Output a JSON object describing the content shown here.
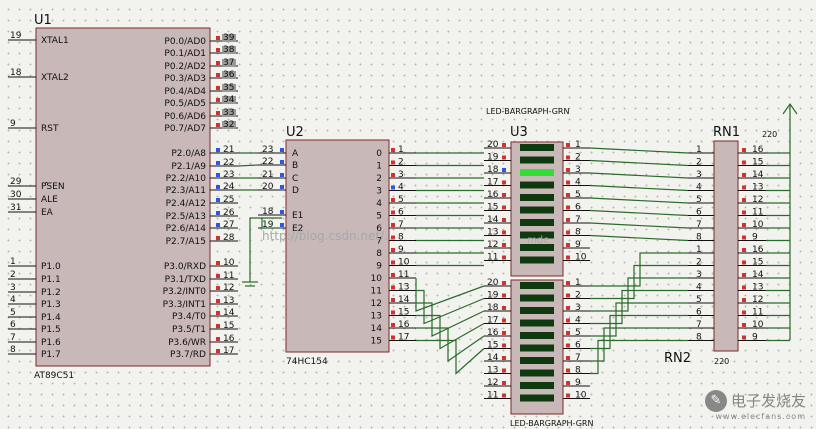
{
  "u1": {
    "ref": "U1",
    "part": "AT89C51",
    "left": [
      {
        "num": "19",
        "name": "XTAL1"
      },
      {
        "num": "18",
        "name": "XTAL2"
      },
      {
        "num": "9",
        "name": "RST"
      },
      {
        "num": "29",
        "name": "PSEN"
      },
      {
        "num": "30",
        "name": "ALE"
      },
      {
        "num": "31",
        "name": "EA"
      },
      {
        "num": "1",
        "name": "P1.0"
      },
      {
        "num": "2",
        "name": "P1.1"
      },
      {
        "num": "3",
        "name": "P1.2"
      },
      {
        "num": "4",
        "name": "P1.3"
      },
      {
        "num": "5",
        "name": "P1.4"
      },
      {
        "num": "6",
        "name": "P1.5"
      },
      {
        "num": "7",
        "name": "P1.6"
      },
      {
        "num": "8",
        "name": "P1.7"
      }
    ],
    "right": [
      {
        "num": "39",
        "name": "P0.0/AD0"
      },
      {
        "num": "38",
        "name": "P0.1/AD1"
      },
      {
        "num": "37",
        "name": "P0.2/AD2"
      },
      {
        "num": "36",
        "name": "P0.3/AD3"
      },
      {
        "num": "35",
        "name": "P0.4/AD4"
      },
      {
        "num": "34",
        "name": "P0.5/AD5"
      },
      {
        "num": "33",
        "name": "P0.6/AD6"
      },
      {
        "num": "32",
        "name": "P0.7/AD7"
      },
      {
        "num": "21",
        "name": "P2.0/A8"
      },
      {
        "num": "22",
        "name": "P2.1/A9"
      },
      {
        "num": "23",
        "name": "P2.2/A10"
      },
      {
        "num": "24",
        "name": "P2.3/A11"
      },
      {
        "num": "25",
        "name": "P2.4/A12"
      },
      {
        "num": "26",
        "name": "P2.5/A13"
      },
      {
        "num": "27",
        "name": "P2.6/A14"
      },
      {
        "num": "28",
        "name": "P2.7/A15"
      },
      {
        "num": "10",
        "name": "P3.0/RXD"
      },
      {
        "num": "11",
        "name": "P3.1/TXD"
      },
      {
        "num": "12",
        "name": "P3.2/INT0"
      },
      {
        "num": "13",
        "name": "P3.3/INT1"
      },
      {
        "num": "14",
        "name": "P3.4/T0"
      },
      {
        "num": "15",
        "name": "P3.5/T1"
      },
      {
        "num": "16",
        "name": "P3.6/WR"
      },
      {
        "num": "17",
        "name": "P3.7/RD"
      }
    ]
  },
  "u2": {
    "ref": "U2",
    "part": "74HC154",
    "left": [
      {
        "num": "23",
        "name": "A"
      },
      {
        "num": "22",
        "name": "B"
      },
      {
        "num": "21",
        "name": "C"
      },
      {
        "num": "20",
        "name": "D"
      },
      {
        "num": "18",
        "name": "E1"
      },
      {
        "num": "19",
        "name": "E2"
      }
    ],
    "right": [
      {
        "num": "1",
        "name": "0"
      },
      {
        "num": "2",
        "name": "1"
      },
      {
        "num": "3",
        "name": "2"
      },
      {
        "num": "4",
        "name": "3"
      },
      {
        "num": "5",
        "name": "4"
      },
      {
        "num": "6",
        "name": "5"
      },
      {
        "num": "7",
        "name": "6"
      },
      {
        "num": "8",
        "name": "7"
      },
      {
        "num": "9",
        "name": "8"
      },
      {
        "num": "10",
        "name": "9"
      },
      {
        "num": "11",
        "name": "10"
      },
      {
        "num": "13",
        "name": "11"
      },
      {
        "num": "14",
        "name": "12"
      },
      {
        "num": "15",
        "name": "13"
      },
      {
        "num": "16",
        "name": "14"
      },
      {
        "num": "17",
        "name": "15"
      }
    ]
  },
  "u3": {
    "ref": "U3",
    "part": "LED-BARGRAPH-GRN",
    "left_pins": [
      "20",
      "19",
      "18",
      "17",
      "16",
      "15",
      "14",
      "13",
      "12",
      "11"
    ],
    "right_pins": [
      "1",
      "2",
      "3",
      "4",
      "5",
      "6",
      "7",
      "8",
      "9",
      "10"
    ],
    "lit_segment": 3
  },
  "u4": {
    "part": "LED-BARGRAPH-GRN",
    "left_pins": [
      "20",
      "19",
      "18",
      "17",
      "16",
      "15",
      "14",
      "13",
      "12",
      "11"
    ],
    "right_pins": [
      "1",
      "2",
      "3",
      "4",
      "5",
      "6",
      "7",
      "8",
      "9",
      "10"
    ]
  },
  "rn1": {
    "ref": "RN1",
    "value": "220",
    "left_pins": [
      "1",
      "2",
      "3",
      "4",
      "5",
      "6",
      "7",
      "8"
    ],
    "right_pins": [
      "16",
      "15",
      "14",
      "13",
      "12",
      "11",
      "10",
      "9"
    ]
  },
  "rn2": {
    "ref": "RN2",
    "value": "220",
    "left_pins": [
      "1",
      "2",
      "3",
      "4",
      "5",
      "6",
      "7",
      "8"
    ],
    "right_pins": [
      "16",
      "15",
      "14",
      "13",
      "12",
      "11",
      "10",
      "9"
    ]
  },
  "watermark": {
    "text": "电子发烧友",
    "url": "www.elecfans.com",
    "faint": "http://blog.csdn.net/...",
    "faint_tail": "mde"
  }
}
